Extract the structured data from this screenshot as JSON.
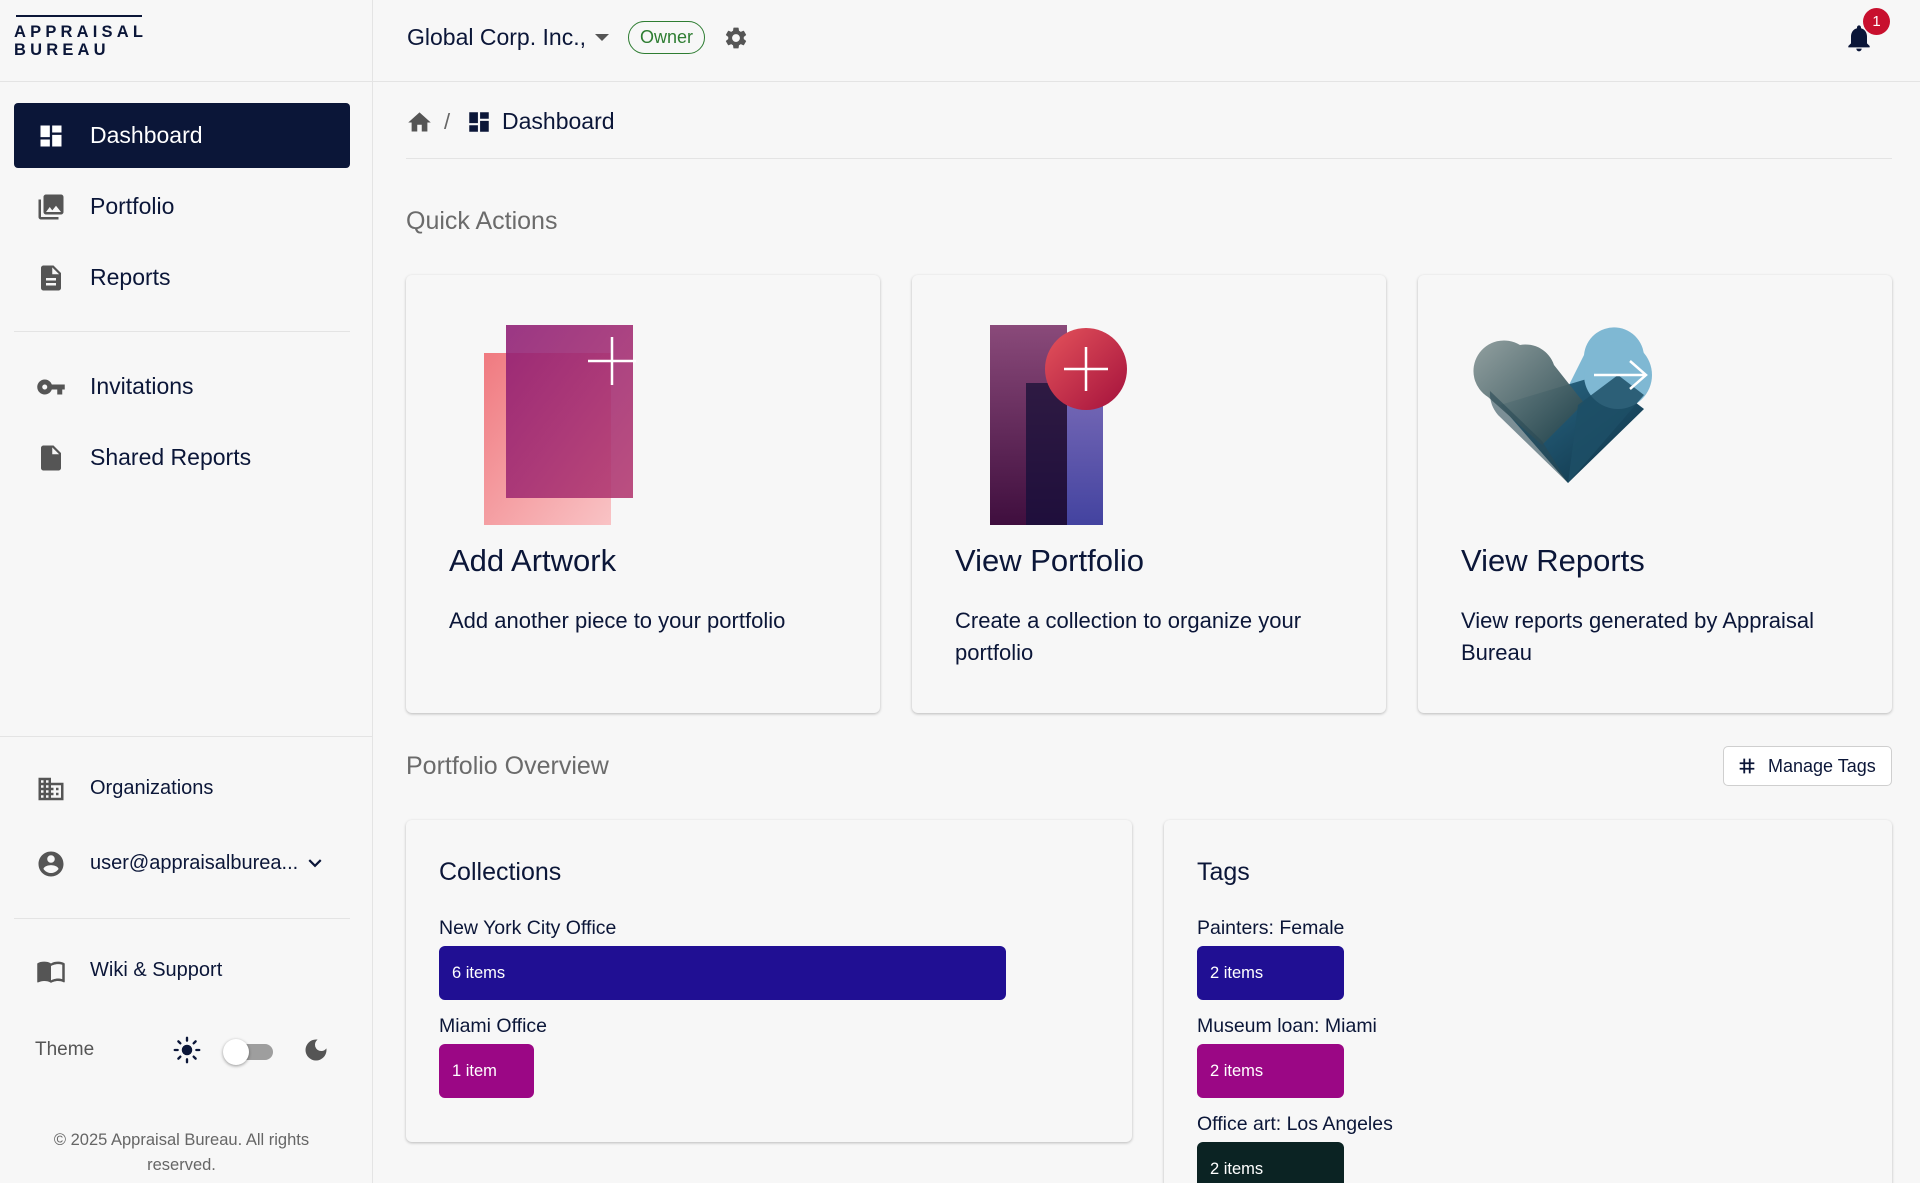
{
  "logo": {
    "line1": "APPRAISAL",
    "line2": "BUREAU"
  },
  "sidebar": {
    "nav": [
      {
        "label": "Dashboard",
        "icon": "dashboard-icon",
        "active": true
      },
      {
        "label": "Portfolio",
        "icon": "photo-library-icon"
      },
      {
        "label": "Reports",
        "icon": "document-icon"
      }
    ],
    "nav2": [
      {
        "label": "Invitations",
        "icon": "key-icon"
      },
      {
        "label": "Shared Reports",
        "icon": "file-icon"
      }
    ],
    "organizations_label": "Organizations",
    "user_email": "user@appraisalburea...",
    "wiki_label": "Wiki & Support",
    "theme_label": "Theme",
    "footer": "© 2025 Appraisal Bureau. All rights reserved."
  },
  "header": {
    "org_name": "Global Corp. Inc.,",
    "role_badge": "Owner",
    "notification_count": "1"
  },
  "breadcrumb": {
    "current": "Dashboard"
  },
  "quick_actions": {
    "title": "Quick Actions",
    "cards": [
      {
        "title": "Add Artwork",
        "description": "Add another piece to your portfolio"
      },
      {
        "title": "View Portfolio",
        "description": "Create a collection to organize your portfolio"
      },
      {
        "title": "View Reports",
        "description": "View reports generated by Appraisal Bureau"
      }
    ]
  },
  "portfolio_overview": {
    "title": "Portfolio Overview",
    "manage_tags_label": "Manage Tags",
    "collections": {
      "title": "Collections",
      "items": [
        {
          "name": "New York City Office",
          "count_label": "6 items",
          "count": 6,
          "color": "#200f93"
        },
        {
          "name": "Miami Office",
          "count_label": "1 item",
          "count": 1,
          "color": "#9b0785"
        }
      ]
    },
    "tags": {
      "title": "Tags",
      "items": [
        {
          "name": "Painters: Female",
          "count_label": "2 items",
          "count": 2,
          "color": "#200f93"
        },
        {
          "name": "Museum loan: Miami",
          "count_label": "2 items",
          "count": 2,
          "color": "#9b0785"
        },
        {
          "name": "Office art: Los Angeles",
          "count_label": "2 items",
          "count": 2,
          "color": "#0b2323"
        }
      ]
    }
  },
  "colors": {
    "navy": "#0b1638",
    "owner_green": "#2e7d32",
    "badge_red": "#c8102e"
  }
}
